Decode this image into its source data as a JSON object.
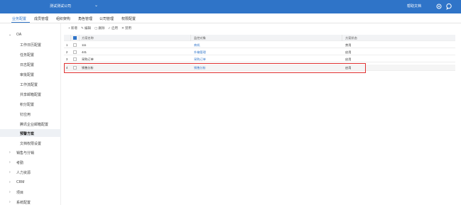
{
  "topbar": {
    "company": "测试测试公司",
    "help": "帮助文档"
  },
  "tabs": [
    "业务配置",
    "成员管理",
    "组织架构",
    "角色管理",
    "公司管理",
    "权限配置"
  ],
  "sidebar": {
    "section": "OA",
    "items": [
      "工作日历配置",
      "任务配置",
      "日志配置",
      "审批配置",
      "工作流配置",
      "共享邮箱配置",
      "积分配置",
      "钉应用",
      "腾讯企业邮箱配置",
      "预警方案",
      "文档权限设置"
    ],
    "selected_index": 9,
    "groups": [
      "销售与分销",
      "考勤",
      "人力资源",
      "CRM",
      "项目",
      "系统配置"
    ]
  },
  "toolbar": {
    "add": "新增",
    "edit": "编辑",
    "delete": "删除",
    "enable": "启用",
    "disable": "禁用"
  },
  "table": {
    "columns": [
      "方案名称",
      "监控对象",
      "方案状态"
    ],
    "rows": [
      {
        "no": "1",
        "name": "111",
        "object": "商机",
        "status": "禁用"
      },
      {
        "no": "2",
        "name": "441",
        "object": "外箱管理",
        "status": "启用"
      },
      {
        "no": "3",
        "name": "采购订单",
        "object": "采购订单",
        "status": "启用"
      },
      {
        "no": "4",
        "name": "销售分析",
        "object": "销售分析",
        "status": "启用"
      }
    ]
  },
  "colors": {
    "brand": "#2f74c8",
    "highlight_border": "#e03232"
  }
}
